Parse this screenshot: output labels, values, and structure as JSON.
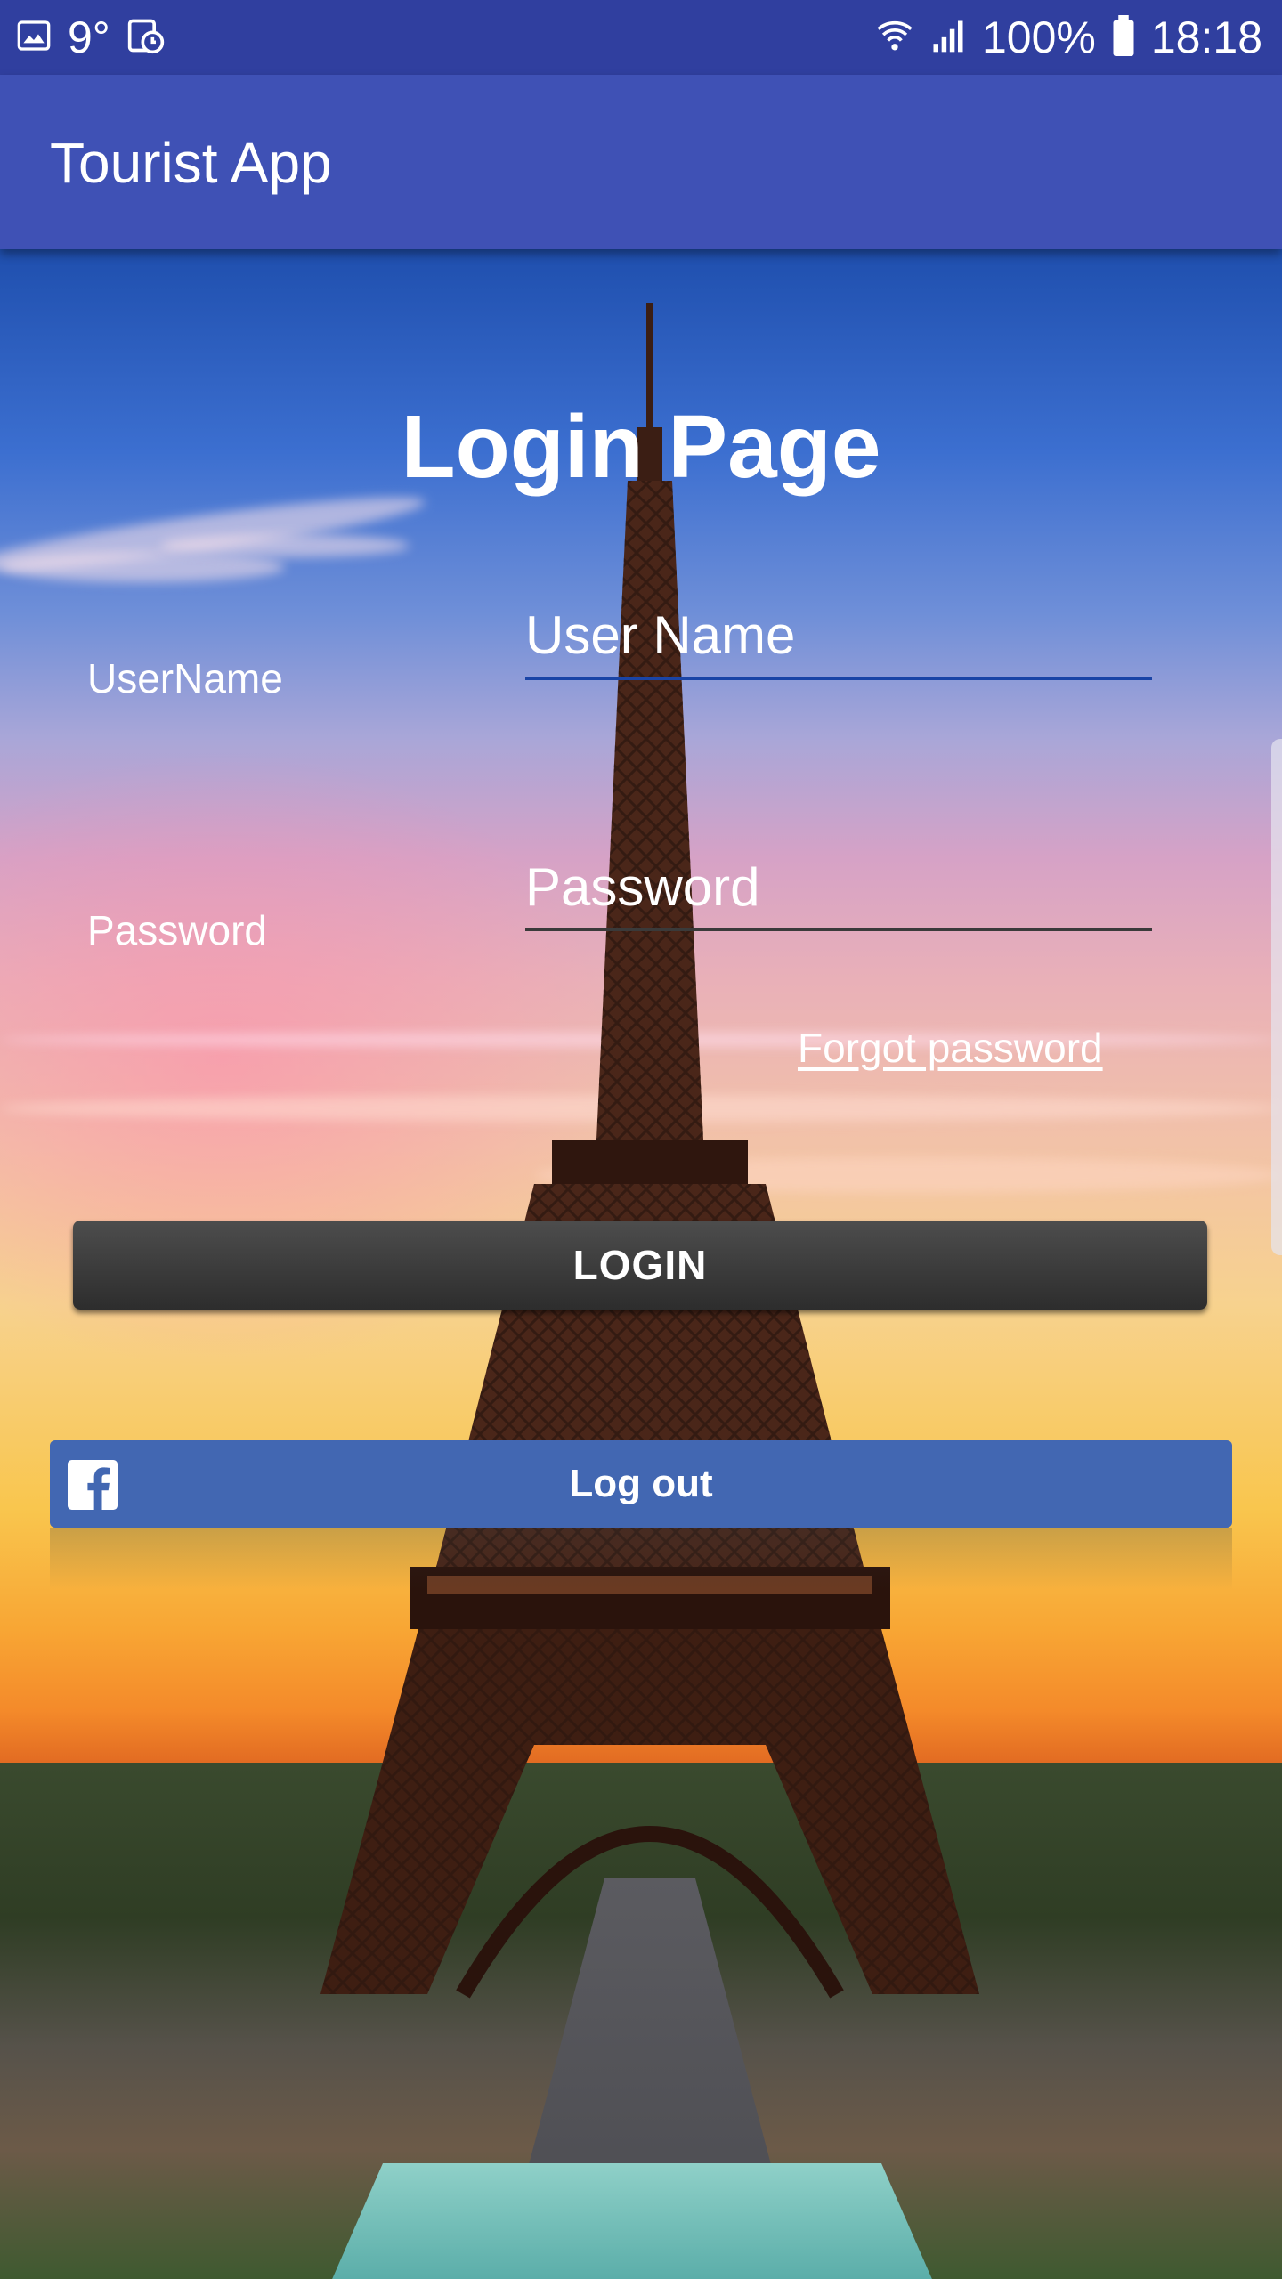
{
  "status_bar": {
    "temperature": "9°",
    "battery": "100%",
    "time": "18:18"
  },
  "app_bar": {
    "title": "Tourist App"
  },
  "login_form": {
    "heading": "Login Page",
    "username_label": "UserName",
    "username_placeholder": "User Name",
    "password_label": "Password",
    "password_placeholder": "Password",
    "forgot_password": "Forgot password",
    "login_button": "LOGIN",
    "facebook_button": "Log out"
  },
  "colors": {
    "status_bar": "#303f9f",
    "app_bar": "#3f51b5",
    "username_underline_focused": "#1a44a6",
    "password_underline": "#3a3a3a",
    "facebook_blue": "#4267b2",
    "login_button": "#3a3a3a"
  },
  "icons": {
    "status_left": [
      "image-icon",
      "calendar-clock-icon"
    ],
    "status_right": [
      "wifi-icon",
      "signal-icon",
      "battery-icon"
    ],
    "facebook": "facebook-icon"
  }
}
